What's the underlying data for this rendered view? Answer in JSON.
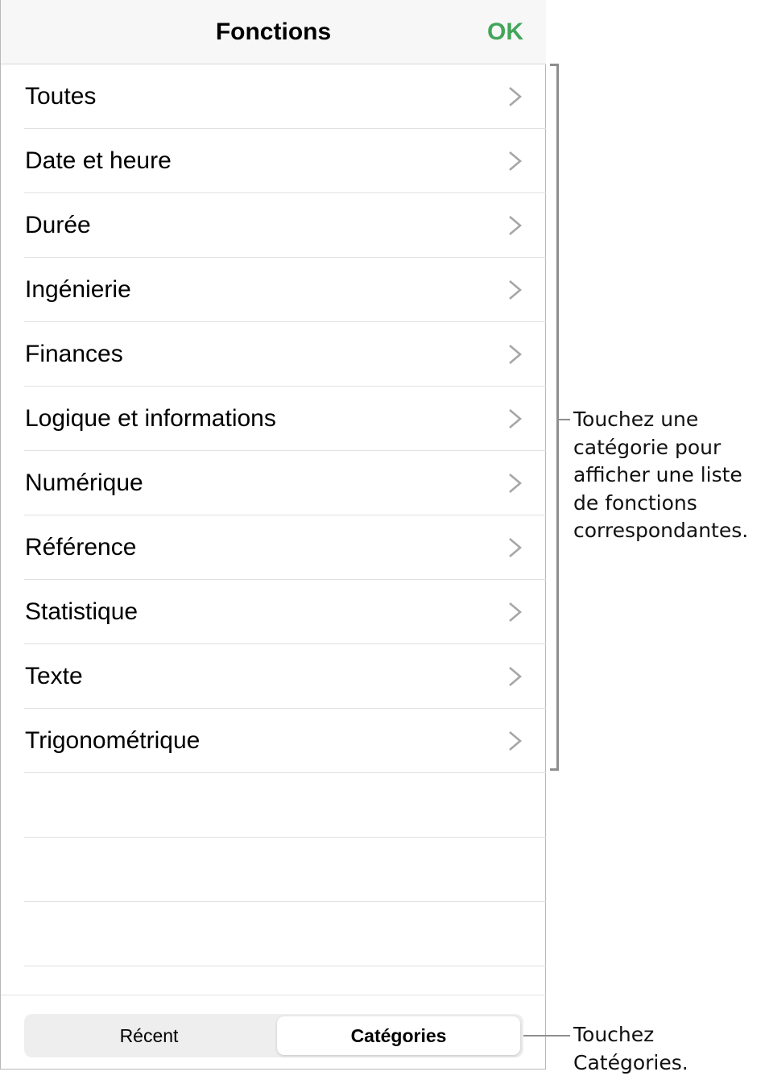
{
  "header": {
    "title": "Fonctions",
    "ok_label": "OK",
    "ok_color": "#43a55a"
  },
  "categories": [
    {
      "label": "Toutes"
    },
    {
      "label": "Date et heure"
    },
    {
      "label": "Durée"
    },
    {
      "label": "Ingénierie"
    },
    {
      "label": "Finances"
    },
    {
      "label": "Logique et informations"
    },
    {
      "label": "Numérique"
    },
    {
      "label": "Référence"
    },
    {
      "label": "Statistique"
    },
    {
      "label": "Texte"
    },
    {
      "label": "Trigonométrique"
    }
  ],
  "segmented": {
    "recent_label": "Récent",
    "categories_label": "Catégories",
    "selected": "Catégories"
  },
  "callouts": {
    "list": [
      "Touchez une",
      "catégorie pour",
      "afficher une liste",
      "de fonctions",
      "correspondantes."
    ],
    "tab": [
      "Touchez",
      "Catégories."
    ]
  }
}
